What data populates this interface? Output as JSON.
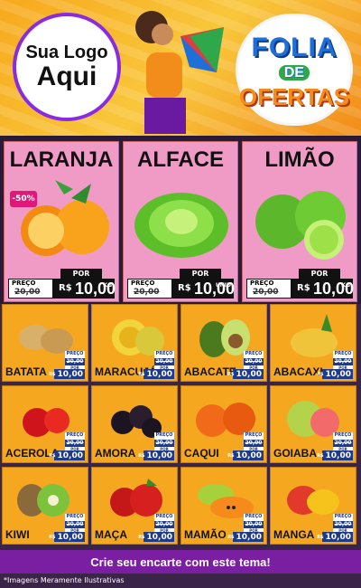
{
  "header": {
    "logo_line1": "Sua Logo",
    "logo_line2": "Aqui",
    "badge_line1": "FOLIA",
    "badge_line2": "DE",
    "badge_line3": "OFERTAS"
  },
  "featured": [
    {
      "name": "LARANJA",
      "discount": "-50%",
      "preco_label": "PREÇO",
      "old_price": "20,00",
      "por_label": "POR",
      "currency": "R$",
      "price": "10,00",
      "unit": "KG"
    },
    {
      "name": "ALFACE",
      "preco_label": "PREÇO",
      "old_price": "20,00",
      "por_label": "POR",
      "currency": "R$",
      "price": "10,00",
      "unit": "UNID"
    },
    {
      "name": "LIMÃO",
      "preco_label": "PREÇO",
      "old_price": "20,00",
      "por_label": "POR",
      "currency": "R$",
      "price": "10,00",
      "unit": "KG"
    }
  ],
  "products": [
    {
      "name": "BATATA",
      "preco_label": "PREÇO",
      "old_price": "20,00",
      "por_label": "POR",
      "currency": "R$",
      "price": "10,00"
    },
    {
      "name": "MARACUJÁ",
      "preco_label": "PREÇO",
      "old_price": "20,00",
      "por_label": "POR",
      "currency": "R$",
      "price": "10,00"
    },
    {
      "name": "ABACATE",
      "preco_label": "PREÇO",
      "old_price": "20,00",
      "por_label": "POR",
      "currency": "R$",
      "price": "10,00"
    },
    {
      "name": "ABACAXI",
      "preco_label": "PREÇO",
      "old_price": "20,00",
      "por_label": "POR",
      "currency": "R$",
      "price": "10,00"
    },
    {
      "name": "ACEROLA",
      "preco_label": "PREÇO",
      "old_price": "20,00",
      "por_label": "POR",
      "currency": "R$",
      "price": "10,00"
    },
    {
      "name": "AMORA",
      "preco_label": "PREÇO",
      "old_price": "20,00",
      "por_label": "POR",
      "currency": "R$",
      "price": "10,00"
    },
    {
      "name": "CAQUI",
      "preco_label": "PREÇO",
      "old_price": "20,00",
      "por_label": "POR",
      "currency": "R$",
      "price": "10,00"
    },
    {
      "name": "GOIABA",
      "preco_label": "PREÇO",
      "old_price": "20,00",
      "por_label": "POR",
      "currency": "R$",
      "price": "10,00"
    },
    {
      "name": "KIWI",
      "preco_label": "PREÇO",
      "old_price": "20,00",
      "por_label": "POR",
      "currency": "R$",
      "price": "10,00"
    },
    {
      "name": "MAÇA",
      "preco_label": "PREÇO",
      "old_price": "20,00",
      "por_label": "POR",
      "currency": "R$",
      "price": "10,00"
    },
    {
      "name": "MAMÃO",
      "preco_label": "PREÇO",
      "old_price": "20,00",
      "por_label": "POR",
      "currency": "R$",
      "price": "10,00"
    },
    {
      "name": "MANGA",
      "preco_label": "PREÇO",
      "old_price": "20,00",
      "por_label": "POR",
      "currency": "R$",
      "price": "10,00"
    }
  ],
  "cta": "Crie seu encarte com este tema!",
  "footnote": "*Imagens Meramente Ilustrativas",
  "colors": {
    "accent": "#7b1fa2",
    "card": "#f5a81f",
    "featured": "#f09bc6",
    "price_bg": "#1e3a8a"
  }
}
